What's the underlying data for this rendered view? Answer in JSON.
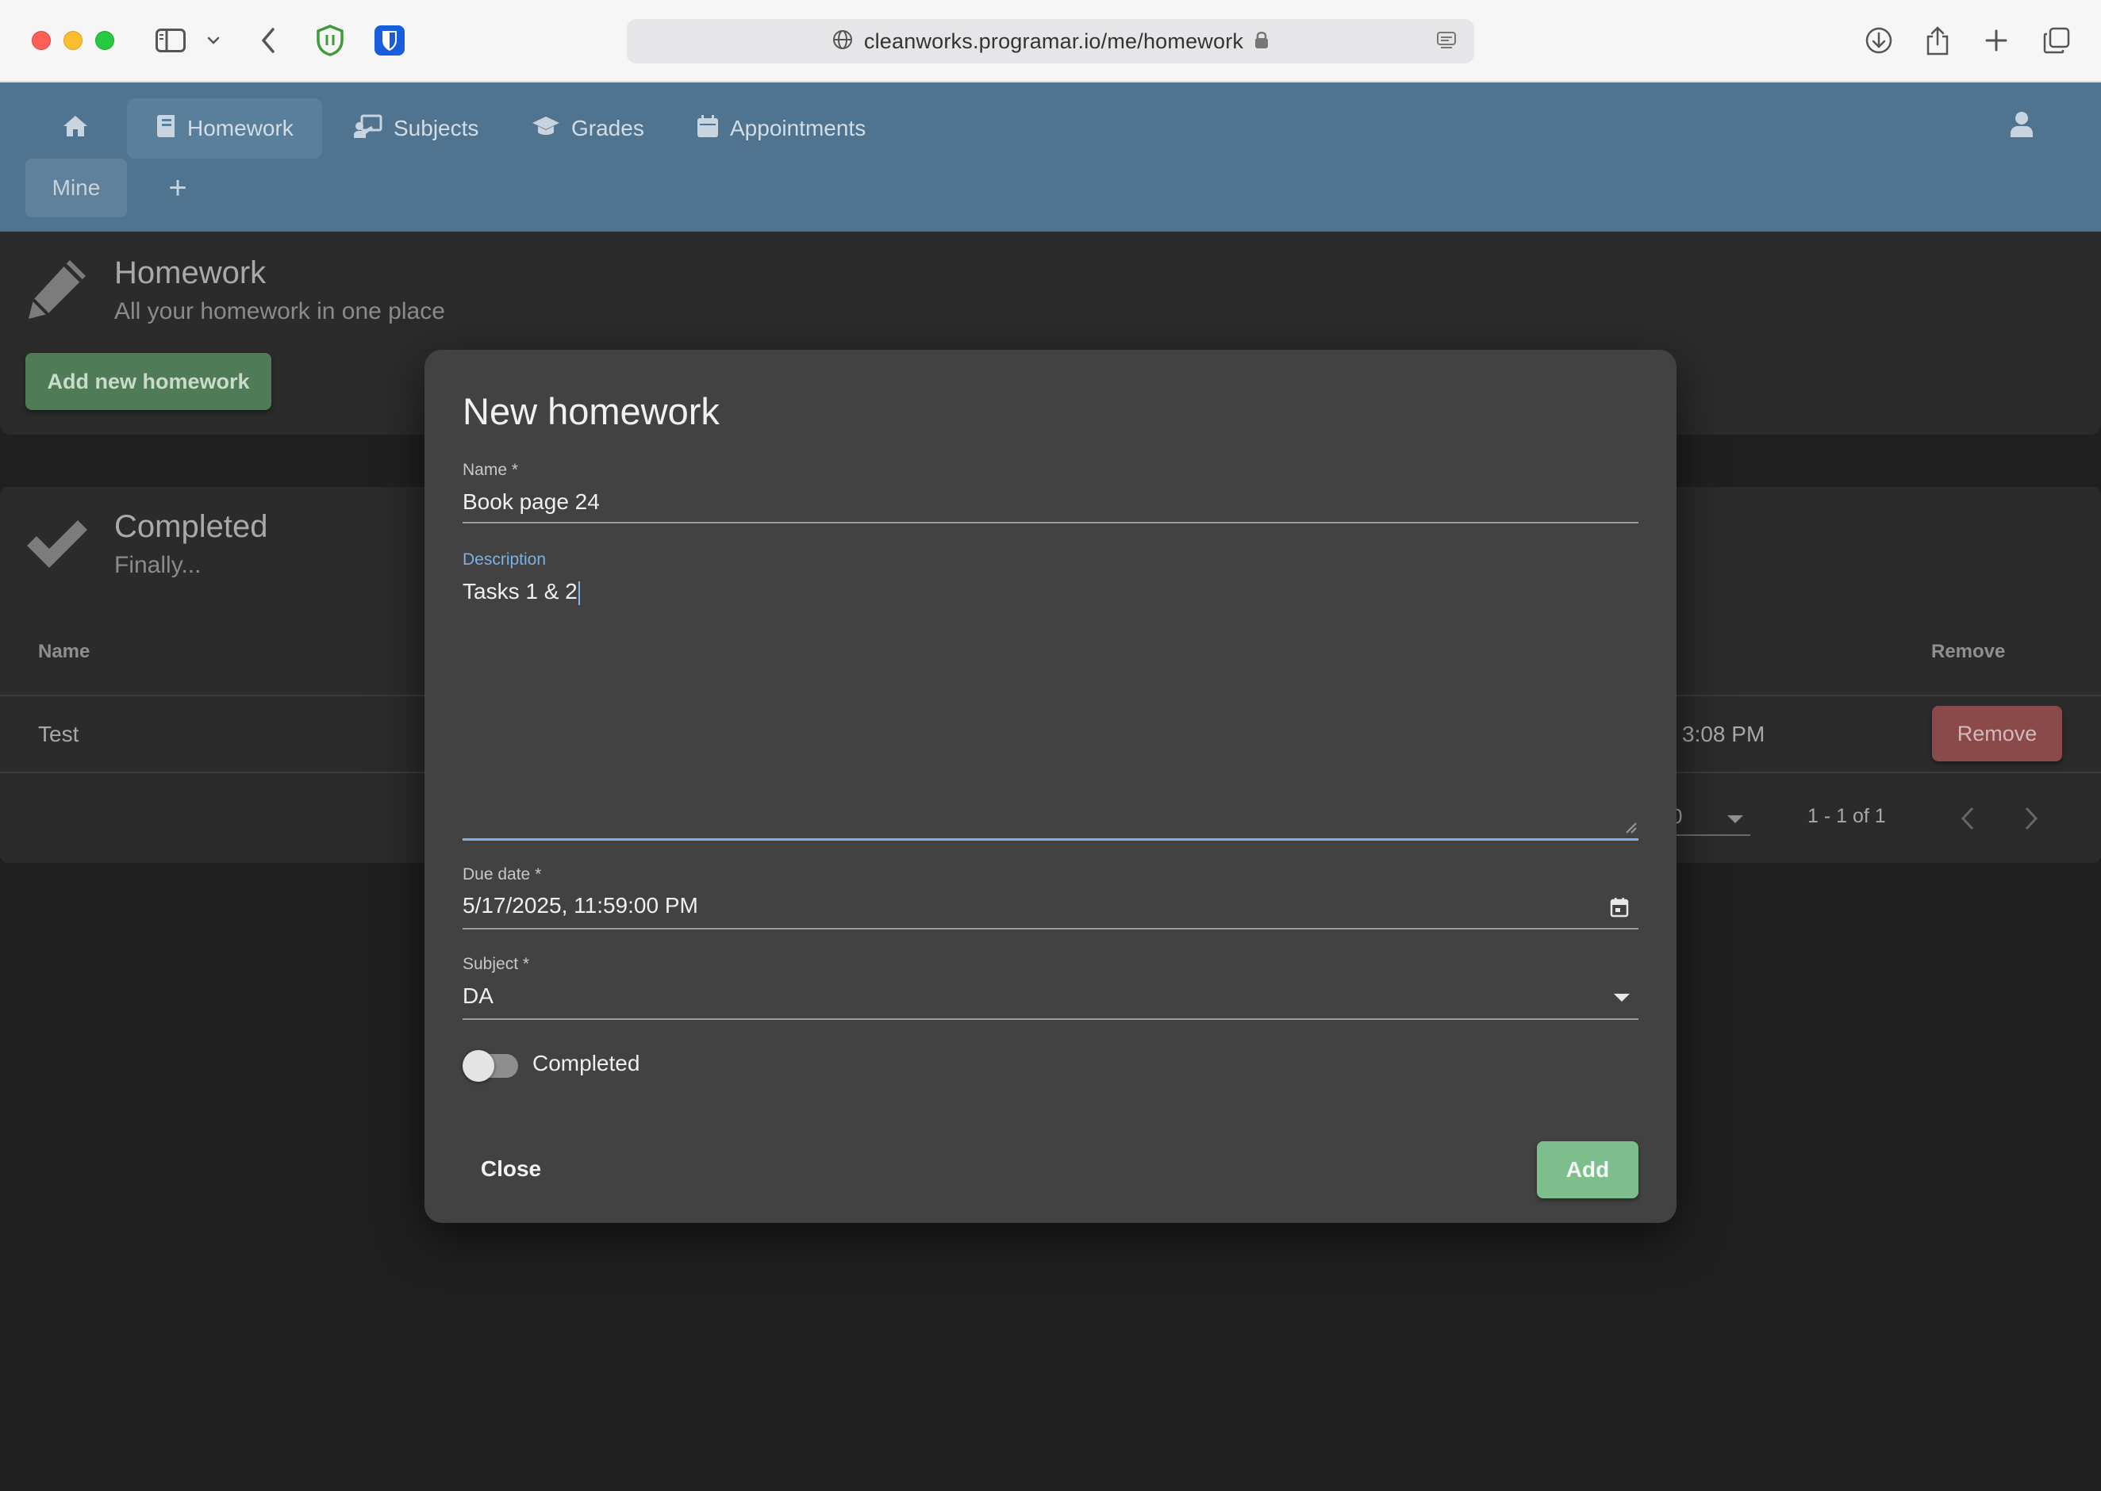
{
  "browser": {
    "url": "cleanworks.programar.io/me/homework"
  },
  "nav": {
    "items": [
      {
        "label": "",
        "icon": "home-icon"
      },
      {
        "label": "Homework",
        "icon": "book-icon",
        "active": true
      },
      {
        "label": "Subjects",
        "icon": "teacher-icon"
      },
      {
        "label": "Grades",
        "icon": "graduation-cap-icon"
      },
      {
        "label": "Appointments",
        "icon": "calendar-icon"
      }
    ],
    "mine_label": "Mine",
    "add_label": "+"
  },
  "homework_card": {
    "title": "Homework",
    "subtitle": "All your homework in one place",
    "add_button": "Add new homework"
  },
  "completed_card": {
    "title": "Completed",
    "subtitle": "Finally...",
    "columns": {
      "name": "Name",
      "remove": "Remove"
    },
    "rows": [
      {
        "name": "Test",
        "time": "3:08 PM",
        "remove_label": "Remove"
      }
    ],
    "pagination": {
      "per_page": "0",
      "range": "1 - 1 of 1"
    }
  },
  "dialog": {
    "title": "New homework",
    "name_label": "Name *",
    "name_value": "Book page 24",
    "description_label": "Description",
    "description_value": "Tasks 1 & 2",
    "due_label": "Due date *",
    "due_value": "5/17/2025, 11:59:00 PM",
    "subject_label": "Subject *",
    "subject_value": "DA",
    "completed_label": "Completed",
    "completed_checked": false,
    "close_label": "Close",
    "add_label": "Add"
  },
  "colors": {
    "nav_bg": "#50738f",
    "dialog_bg": "#424242",
    "accent_focus": "#79b2e4",
    "add_button": "#7dbe8c",
    "remove_button": "#8a4a4a"
  }
}
